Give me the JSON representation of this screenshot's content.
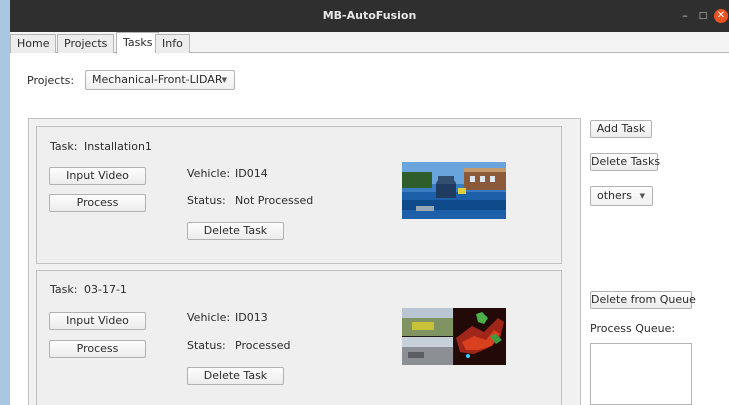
{
  "window": {
    "title": "MB-AutoFusion",
    "minimize": "–",
    "maximize": "□",
    "close": "✕"
  },
  "tabs": [
    {
      "label": "Home"
    },
    {
      "label": "Projects"
    },
    {
      "label": "Tasks",
      "active": true
    },
    {
      "label": "Info"
    }
  ],
  "projects": {
    "label": "Projects:",
    "selected": "Mechanical-Front-LIDAR"
  },
  "tasks": [
    {
      "task_label": "Task:",
      "task_name": "Installation1",
      "input_video": "Input Video",
      "process": "Process",
      "vehicle_label": "Vehicle:",
      "vehicle": "ID014",
      "status_label": "Status:",
      "status": "Not Processed",
      "delete": "Delete Task"
    },
    {
      "task_label": "Task:",
      "task_name": "03-17-1",
      "input_video": "Input Video",
      "process": "Process",
      "vehicle_label": "Vehicle:",
      "vehicle": "ID013",
      "status_label": "Status:",
      "status": "Processed",
      "delete": "Delete Task"
    }
  ],
  "side": {
    "add_task": "Add Task",
    "delete_tasks": "Delete Tasks",
    "filter": "others",
    "delete_from_queue": "Delete from Queue",
    "queue_label": "Process Queue:"
  }
}
